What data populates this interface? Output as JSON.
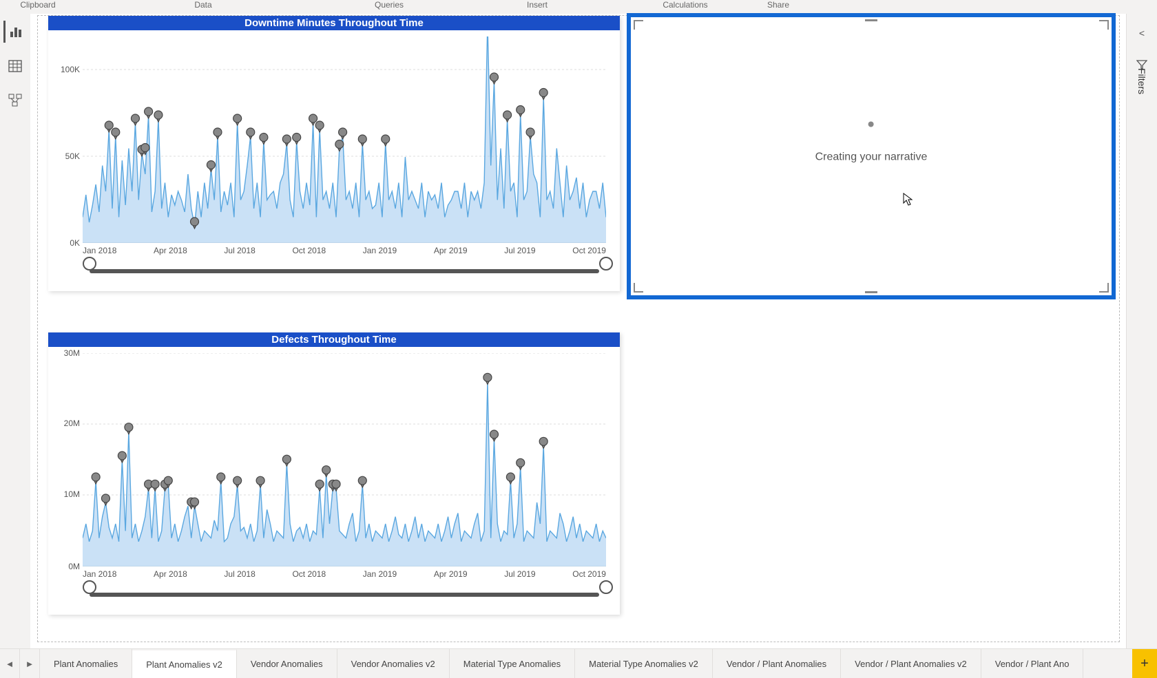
{
  "ribbon_groups": [
    "Clipboard",
    "Data",
    "Queries",
    "Insert",
    "Calculations",
    "Share"
  ],
  "nav_rail": {
    "report": "Report view",
    "data": "Data view",
    "model": "Model view"
  },
  "narrative": {
    "loading_text": "Creating your narrative"
  },
  "right_pane": {
    "collapse": "<",
    "filters_label": "Filters"
  },
  "tab_nav": {
    "prev": "◄",
    "next": "►"
  },
  "page_tabs": [
    {
      "label": "Plant Anomalies",
      "active": false
    },
    {
      "label": "Plant Anomalies v2",
      "active": true
    },
    {
      "label": "Vendor Anomalies",
      "active": false
    },
    {
      "label": "Vendor Anomalies v2",
      "active": false
    },
    {
      "label": "Material Type Anomalies",
      "active": false
    },
    {
      "label": "Material Type Anomalies v2",
      "active": false
    },
    {
      "label": "Vendor / Plant Anomalies",
      "active": false
    },
    {
      "label": "Vendor / Plant Anomalies v2",
      "active": false
    },
    {
      "label": "Vendor / Plant Ano",
      "active": false
    }
  ],
  "add_page": "+",
  "chart_data": [
    {
      "type": "line",
      "title": "Downtime Minutes Throughout Time",
      "xlabel": "",
      "ylabel": "",
      "y_ticks": [
        "0K",
        "50K",
        "100K"
      ],
      "x_ticks": [
        "Jan 2018",
        "Apr 2018",
        "Jul 2018",
        "Oct 2018",
        "Jan 2019",
        "Apr 2019",
        "Jul 2019",
        "Oct 2019"
      ],
      "ylim": [
        0,
        120000
      ],
      "x": [
        0,
        1,
        2,
        3,
        4,
        5,
        6,
        7,
        8,
        9,
        10,
        11,
        12,
        13,
        14,
        15,
        16,
        17,
        18,
        19,
        20,
        21,
        22,
        23,
        24,
        25,
        26,
        27,
        28,
        29,
        30,
        31,
        32,
        33,
        34,
        35,
        36,
        37,
        38,
        39,
        40,
        41,
        42,
        43,
        44,
        45,
        46,
        47,
        48,
        49,
        50,
        51,
        52,
        53,
        54,
        55,
        56,
        57,
        58,
        59,
        60,
        61,
        62,
        63,
        64,
        65,
        66,
        67,
        68,
        69,
        70,
        71,
        72,
        73,
        74,
        75,
        76,
        77,
        78,
        79,
        80,
        81,
        82,
        83,
        84,
        85,
        86,
        87,
        88,
        89,
        90,
        91,
        92,
        93,
        94,
        95,
        96,
        97,
        98,
        99,
        100,
        101,
        102,
        103,
        104,
        105,
        106,
        107,
        108,
        109,
        110,
        111,
        112,
        113,
        114,
        115,
        116,
        117,
        118,
        119,
        120,
        121,
        122,
        123,
        124,
        125,
        126,
        127,
        128,
        129,
        130,
        131,
        132,
        133,
        134,
        135,
        136,
        137,
        138,
        139,
        140,
        141,
        142,
        143,
        144,
        145,
        146,
        147,
        148,
        149,
        150,
        151,
        152,
        153,
        154,
        155,
        156,
        157,
        158,
        159
      ],
      "values": [
        15000,
        28000,
        12000,
        22000,
        34000,
        18000,
        45000,
        30000,
        66000,
        20000,
        62000,
        15000,
        48000,
        22000,
        55000,
        30000,
        70000,
        25000,
        52000,
        40000,
        74000,
        18000,
        30000,
        72000,
        20000,
        35000,
        15000,
        28000,
        22000,
        30000,
        25000,
        18000,
        40000,
        20000,
        10000,
        30000,
        15000,
        35000,
        20000,
        43000,
        25000,
        62000,
        18000,
        30000,
        22000,
        35000,
        15000,
        70000,
        25000,
        30000,
        45000,
        62000,
        20000,
        35000,
        15000,
        59000,
        25000,
        28000,
        30000,
        20000,
        35000,
        40000,
        58000,
        25000,
        15000,
        59000,
        30000,
        20000,
        35000,
        22000,
        70000,
        15000,
        66000,
        25000,
        30000,
        20000,
        35000,
        15000,
        55000,
        62000,
        25000,
        30000,
        20000,
        35000,
        15000,
        58000,
        25000,
        30000,
        20000,
        22000,
        35000,
        15000,
        58000,
        25000,
        30000,
        20000,
        35000,
        15000,
        50000,
        25000,
        30000,
        25000,
        20000,
        35000,
        15000,
        30000,
        25000,
        28000,
        20000,
        35000,
        15000,
        22000,
        25000,
        30000,
        30000,
        20000,
        35000,
        15000,
        30000,
        25000,
        30000,
        20000,
        35000,
        128000,
        45000,
        94000,
        25000,
        55000,
        20000,
        72000,
        30000,
        35000,
        15000,
        75000,
        25000,
        30000,
        62000,
        40000,
        35000,
        15000,
        85000,
        25000,
        30000,
        20000,
        55000,
        35000,
        15000,
        45000,
        25000,
        30000,
        38000,
        20000,
        35000,
        15000,
        25000,
        30000,
        30000,
        20000,
        35000,
        15000
      ],
      "anomalies": [
        {
          "x": 8,
          "y": 66000
        },
        {
          "x": 10,
          "y": 62000
        },
        {
          "x": 16,
          "y": 70000
        },
        {
          "x": 18,
          "y": 52000
        },
        {
          "x": 19,
          "y": 53000
        },
        {
          "x": 20,
          "y": 74000
        },
        {
          "x": 23,
          "y": 72000
        },
        {
          "x": 34,
          "y": 10000
        },
        {
          "x": 39,
          "y": 43000
        },
        {
          "x": 41,
          "y": 62000
        },
        {
          "x": 47,
          "y": 70000
        },
        {
          "x": 51,
          "y": 62000
        },
        {
          "x": 55,
          "y": 59000
        },
        {
          "x": 62,
          "y": 58000
        },
        {
          "x": 65,
          "y": 59000
        },
        {
          "x": 70,
          "y": 70000
        },
        {
          "x": 72,
          "y": 66000
        },
        {
          "x": 78,
          "y": 55000
        },
        {
          "x": 79,
          "y": 62000
        },
        {
          "x": 85,
          "y": 58000
        },
        {
          "x": 92,
          "y": 58000
        },
        {
          "x": 123,
          "y": 128000
        },
        {
          "x": 125,
          "y": 94000
        },
        {
          "x": 129,
          "y": 72000
        },
        {
          "x": 133,
          "y": 75000
        },
        {
          "x": 136,
          "y": 62000
        },
        {
          "x": 140,
          "y": 85000
        }
      ]
    },
    {
      "type": "line",
      "title": "Defects Throughout Time",
      "xlabel": "",
      "ylabel": "",
      "y_ticks": [
        "0M",
        "10M",
        "20M",
        "30M"
      ],
      "x_ticks": [
        "Jan 2018",
        "Apr 2018",
        "Jul 2018",
        "Oct 2018",
        "Jan 2019",
        "Apr 2019",
        "Jul 2019",
        "Oct 2019"
      ],
      "ylim": [
        0,
        30000000
      ],
      "x": [
        0,
        1,
        2,
        3,
        4,
        5,
        6,
        7,
        8,
        9,
        10,
        11,
        12,
        13,
        14,
        15,
        16,
        17,
        18,
        19,
        20,
        21,
        22,
        23,
        24,
        25,
        26,
        27,
        28,
        29,
        30,
        31,
        32,
        33,
        34,
        35,
        36,
        37,
        38,
        39,
        40,
        41,
        42,
        43,
        44,
        45,
        46,
        47,
        48,
        49,
        50,
        51,
        52,
        53,
        54,
        55,
        56,
        57,
        58,
        59,
        60,
        61,
        62,
        63,
        64,
        65,
        66,
        67,
        68,
        69,
        70,
        71,
        72,
        73,
        74,
        75,
        76,
        77,
        78,
        79,
        80,
        81,
        82,
        83,
        84,
        85,
        86,
        87,
        88,
        89,
        90,
        91,
        92,
        93,
        94,
        95,
        96,
        97,
        98,
        99,
        100,
        101,
        102,
        103,
        104,
        105,
        106,
        107,
        108,
        109,
        110,
        111,
        112,
        113,
        114,
        115,
        116,
        117,
        118,
        119,
        120,
        121,
        122,
        123,
        124,
        125,
        126,
        127,
        128,
        129,
        130,
        131,
        132,
        133,
        134,
        135,
        136,
        137,
        138,
        139,
        140,
        141,
        142,
        143,
        144,
        145,
        146,
        147,
        148,
        149,
        150,
        151,
        152,
        153,
        154,
        155,
        156,
        157,
        158,
        159
      ],
      "values": [
        4000000,
        6000000,
        3500000,
        5000000,
        12000000,
        4000000,
        7000000,
        9000000,
        5500000,
        4000000,
        6000000,
        3500000,
        15000000,
        5000000,
        19000000,
        4000000,
        6000000,
        3500000,
        5000000,
        7000000,
        11000000,
        4000000,
        11000000,
        3500000,
        5000000,
        11000000,
        11500000,
        4000000,
        6000000,
        3500000,
        5000000,
        7000000,
        8500000,
        4000000,
        8500000,
        6000000,
        3500000,
        5000000,
        4500000,
        4000000,
        6500000,
        5000000,
        12000000,
        3500000,
        4000000,
        6000000,
        7000000,
        11500000,
        5000000,
        5500000,
        4000000,
        6000000,
        3500000,
        5000000,
        11500000,
        4000000,
        8000000,
        6000000,
        3500000,
        5000000,
        4500000,
        4000000,
        14500000,
        6000000,
        3500000,
        5000000,
        5500000,
        4000000,
        6000000,
        3500000,
        5000000,
        4500000,
        11000000,
        4000000,
        13000000,
        6000000,
        11000000,
        11000000,
        5000000,
        4500000,
        4000000,
        6000000,
        7500000,
        3500000,
        5000000,
        11500000,
        4000000,
        6000000,
        3500000,
        5000000,
        4500000,
        4000000,
        6000000,
        3500000,
        5000000,
        7000000,
        4500000,
        4000000,
        6000000,
        3500000,
        5000000,
        7000000,
        4000000,
        6000000,
        3500000,
        5000000,
        4500000,
        4000000,
        6000000,
        3500000,
        5000000,
        7000000,
        4000000,
        6000000,
        7500000,
        3500000,
        5000000,
        4500000,
        4000000,
        6000000,
        7500000,
        3500000,
        5000000,
        26000000,
        4000000,
        18000000,
        6000000,
        3500000,
        5000000,
        4500000,
        12000000,
        4000000,
        6000000,
        14000000,
        3500000,
        5000000,
        4500000,
        4000000,
        9000000,
        6000000,
        17000000,
        3500000,
        5000000,
        4500000,
        4000000,
        7500000,
        6000000,
        3500000,
        5000000,
        7000000,
        4000000,
        6000000,
        3500000,
        5000000,
        4500000,
        4000000,
        6000000,
        3500000,
        5000000,
        4000000
      ],
      "anomalies": [
        {
          "x": 4,
          "y": 12000000
        },
        {
          "x": 7,
          "y": 9000000
        },
        {
          "x": 12,
          "y": 15000000
        },
        {
          "x": 14,
          "y": 19000000
        },
        {
          "x": 20,
          "y": 11000000
        },
        {
          "x": 22,
          "y": 11000000
        },
        {
          "x": 25,
          "y": 11000000
        },
        {
          "x": 26,
          "y": 11500000
        },
        {
          "x": 33,
          "y": 8500000
        },
        {
          "x": 34,
          "y": 8500000
        },
        {
          "x": 42,
          "y": 12000000
        },
        {
          "x": 47,
          "y": 11500000
        },
        {
          "x": 54,
          "y": 11500000
        },
        {
          "x": 62,
          "y": 14500000
        },
        {
          "x": 72,
          "y": 11000000
        },
        {
          "x": 74,
          "y": 13000000
        },
        {
          "x": 76,
          "y": 11000000
        },
        {
          "x": 77,
          "y": 11000000
        },
        {
          "x": 85,
          "y": 11500000
        },
        {
          "x": 123,
          "y": 26000000
        },
        {
          "x": 125,
          "y": 18000000
        },
        {
          "x": 130,
          "y": 12000000
        },
        {
          "x": 133,
          "y": 14000000
        },
        {
          "x": 140,
          "y": 17000000
        }
      ]
    }
  ]
}
